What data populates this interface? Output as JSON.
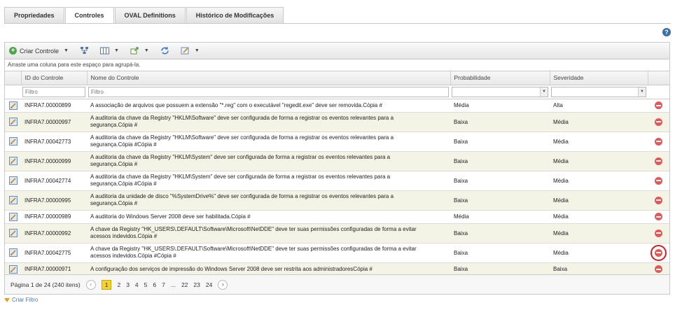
{
  "tabs": [
    {
      "label": "Propriedades"
    },
    {
      "label": "Controles"
    },
    {
      "label": "OVAL Definitions"
    },
    {
      "label": "Histórico de Modificações"
    }
  ],
  "toolbar": {
    "create_control_label": "Criar Controle"
  },
  "group_hint": "Arraste uma coluna para este espaço para agrupá-la.",
  "columns": {
    "id": "ID do Controle",
    "name": "Nome do Controle",
    "probability": "Probabilidade",
    "severity": "Severidade"
  },
  "filter": {
    "placeholder": "Filtro"
  },
  "rows": [
    {
      "id": "INFRA7.00000899",
      "name": "A associação de arquivos que possuem a extensão \"*.reg\" com o executável \"regedit.exe\" deve ser removida.Cópia #",
      "probability": "Média",
      "severity": "Alta"
    },
    {
      "id": "INFRA7.00000997",
      "name": "A auditoria da chave da Registry \"HKLM\\Software\" deve ser configurada de forma a registrar os eventos relevantes para a segurança.Cópia #",
      "probability": "Baixa",
      "severity": "Média"
    },
    {
      "id": "INFRA7.00042773",
      "name": "A auditoria da chave da Registry \"HKLM\\Software\" deve ser configurada de forma a registrar os eventos relevantes para a segurança.Cópia #Cópia #",
      "probability": "Baixa",
      "severity": "Média"
    },
    {
      "id": "INFRA7.00000999",
      "name": "A auditoria da chave da Registry \"HKLM\\System\" deve ser configurada de forma a registrar os eventos relevantes para a segurança.Cópia #",
      "probability": "Baixa",
      "severity": "Média"
    },
    {
      "id": "INFRA7.00042774",
      "name": "A auditoria da chave da Registry \"HKLM\\System\" deve ser configurada de forma a registrar os eventos relevantes para a segurança.Cópia #Cópia #",
      "probability": "Baixa",
      "severity": "Média"
    },
    {
      "id": "INFRA7.00000995",
      "name": "A auditoria da unidade de disco \"%SystemDrive%\" deve ser configurada de forma a registrar os eventos relevantes para a segurança.Cópia #",
      "probability": "Baixa",
      "severity": "Média"
    },
    {
      "id": "INFRA7.00000989",
      "name": "A auditoria do Windows Server 2008 deve ser habilitada.Cópia #",
      "probability": "Média",
      "severity": "Média"
    },
    {
      "id": "INFRA7.00000992",
      "name": "A chave da Registry \"HK_USERS\\.DEFAULT\\Software\\Microsoft\\NetDDE\" deve ter suas permissões configuradas de forma a evitar acessos indevidos.Cópia #",
      "probability": "Baixa",
      "severity": "Média"
    },
    {
      "id": "INFRA7.00042775",
      "name": "A chave da Registry \"HK_USERS\\.DEFAULT\\Software\\Microsoft\\NetDDE\" deve ter suas permissões configuradas de forma a evitar acessos indevidos.Cópia #Cópia #",
      "probability": "Baixa",
      "severity": "Média"
    },
    {
      "id": "INFRA7.00000971",
      "name": "A configuração dos serviços de impressão do Windows Server 2008 deve ser restrita aos administradoresCópia #",
      "probability": "Baixa",
      "severity": "Baixa"
    }
  ],
  "pager": {
    "info": "Página 1 de 24 (240 itens)",
    "pages": [
      "1",
      "2",
      "3",
      "4",
      "5",
      "6",
      "7",
      "...",
      "22",
      "23",
      "24"
    ]
  },
  "create_filter_label": "Criar Filtro"
}
